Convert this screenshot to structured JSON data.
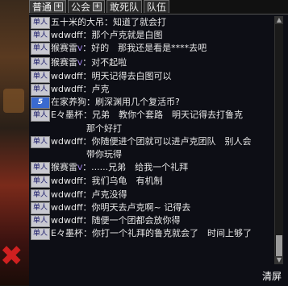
{
  "tabs": [
    {
      "label": "普通",
      "active": true
    },
    {
      "label": "公会",
      "active": false
    },
    {
      "label": "敢死队",
      "active": false
    },
    {
      "label": "队伍",
      "active": false
    }
  ],
  "badge_single": "单人",
  "badge_sys": "5",
  "messages": [
    {
      "badge": "单人",
      "speaker": "五十米的大吊",
      "vip": "",
      "text": "：知道了就会打"
    },
    {
      "badge": "单人",
      "speaker": "wdwdff",
      "vip": "",
      "text": "：那个卢克就是白图"
    },
    {
      "badge": "单人",
      "speaker": "猴赛雷",
      "vip": "V",
      "text": "：好的　那我还是看是****去吧"
    },
    {
      "badge": "单人",
      "speaker": "猴赛雷",
      "vip": "V",
      "text": "：对不起啦"
    },
    {
      "badge": "单人",
      "speaker": "wdwdff",
      "vip": "",
      "text": "：明天记得去白图可以"
    },
    {
      "badge": "单人",
      "speaker": "wdwdff",
      "vip": "",
      "text": "：卢克"
    },
    {
      "badge": "5",
      "speaker": "在家养狗",
      "vip": "",
      "text": "：刷深渊用几个复活币?"
    },
    {
      "badge": "单人",
      "speaker": "E々墨杯",
      "vip": "",
      "text": "：兄弟　教你个套路　明天记得去打鲁克",
      "cont": "那个好打"
    },
    {
      "badge": "单人",
      "speaker": "wdwdff",
      "vip": "",
      "text": "：你随便进个团就可以进卢克团队　别人会",
      "cont": "带你玩得"
    },
    {
      "badge": "单人",
      "speaker": "猴赛雷",
      "vip": "V",
      "text": "：......兄弟　给我一个礼拜"
    },
    {
      "badge": "单人",
      "speaker": "wdwdff",
      "vip": "",
      "text": "：我们乌龟　有机制"
    },
    {
      "badge": "单人",
      "speaker": "wdwdff",
      "vip": "",
      "text": "：卢克没得"
    },
    {
      "badge": "单人",
      "speaker": "wdwdff",
      "vip": "",
      "text": "：你明天去卢克啊~ 记得去"
    },
    {
      "badge": "单人",
      "speaker": "wdwdff",
      "vip": "",
      "text": "：随便一个团都会放你得"
    },
    {
      "badge": "单人",
      "speaker": "E々墨杯",
      "vip": "",
      "text": "：你打一个礼拜的鲁克就会了　时间上够了"
    }
  ],
  "clear_label": "清屏",
  "scroll": {
    "position": 0.95
  },
  "colors": {
    "panel_bg": "#0c0e16",
    "text": "#e6e6e6",
    "badge_bg": "#c8c8d0",
    "sys_badge_bg": "#3a6ad0"
  }
}
